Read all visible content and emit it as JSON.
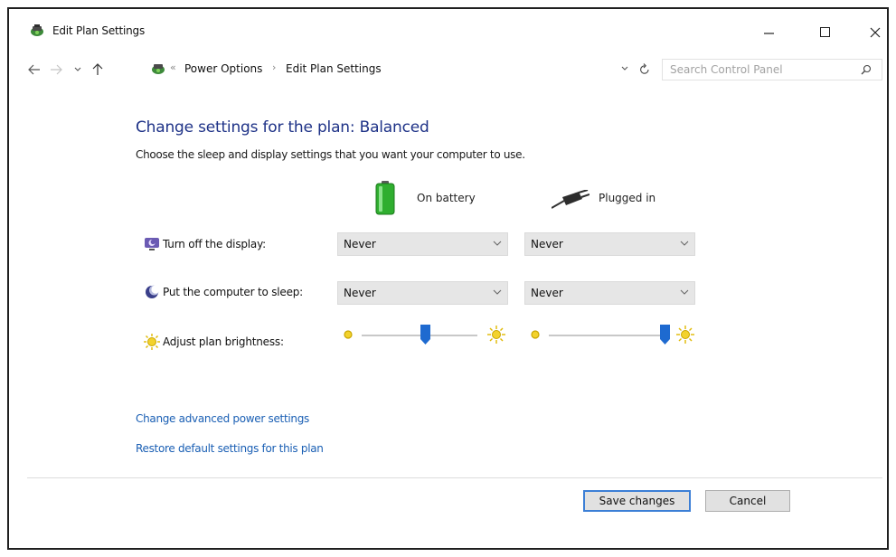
{
  "window": {
    "title": "Edit Plan Settings",
    "icon": "power-options-icon",
    "controls": {
      "minimize": "minimize-icon",
      "maximize": "maximize-icon",
      "close": "close-icon"
    }
  },
  "address_bar": {
    "overflow": "«",
    "breadcrumbs": [
      "Power Options",
      "Edit Plan Settings"
    ],
    "separator": "›",
    "search_placeholder": "Search Control Panel"
  },
  "main": {
    "heading": "Change settings for the plan: Balanced",
    "subheading": "Choose the sleep and display settings that you want your computer to use.",
    "columns": [
      {
        "label": "On battery",
        "icon": "battery-icon"
      },
      {
        "label": "Plugged in",
        "icon": "plug-icon"
      }
    ],
    "settings": [
      {
        "label": "Turn off the display:",
        "icon": "display-icon",
        "battery_value": "Never",
        "plugged_value": "Never"
      },
      {
        "label": "Put the computer to sleep:",
        "icon": "sleep-icon",
        "battery_value": "Never",
        "plugged_value": "Never"
      }
    ],
    "brightness": {
      "label": "Adjust plan brightness:",
      "icon": "brightness-icon",
      "battery_level": 0.55,
      "plugged_level": 1.0
    },
    "links": {
      "advanced": "Change advanced power settings",
      "restore": "Restore default settings for this plan"
    }
  },
  "footer": {
    "save_label": "Save changes",
    "cancel_label": "Cancel"
  },
  "colors": {
    "heading": "#1e3287",
    "link": "#1a5fb4",
    "slider_thumb": "#1e6ad0",
    "button_focus": "#3c7fd6"
  }
}
